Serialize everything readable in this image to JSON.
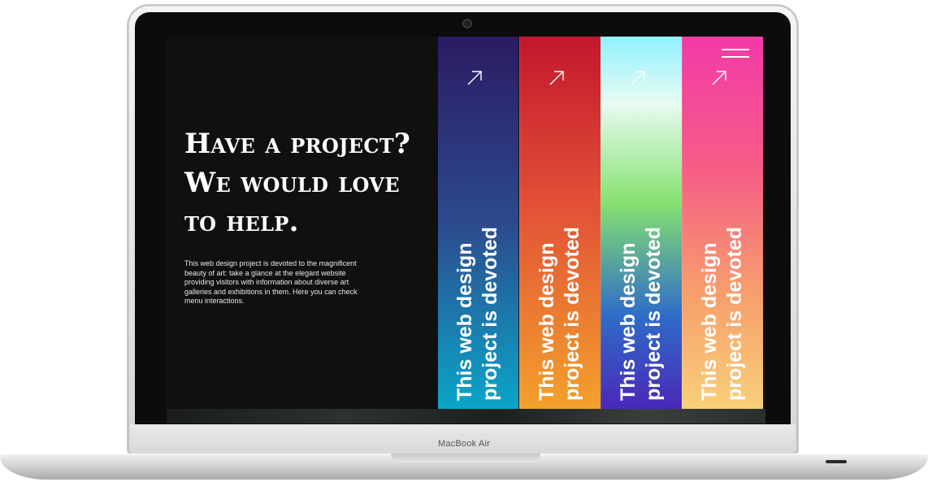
{
  "device": {
    "brand_label": "MacBook Air"
  },
  "hero": {
    "headline_lines": [
      "Have a project?",
      "We would love",
      "to help."
    ],
    "description": "This web design project is devoted to the magnificent beauty of art: take a glance at the elegant website providing visitors with information about diverse art galleries and exhibitions in them. Here you can check menu interactions."
  },
  "panels": [
    {
      "label_line1": "This web design",
      "label_line2": "project is devoted",
      "icon": "arrow-up-right-icon"
    },
    {
      "label_line1": "This web design",
      "label_line2": "project is devoted",
      "icon": "arrow-up-right-icon"
    },
    {
      "label_line1": "This web design",
      "label_line2": "project is devoted",
      "icon": "arrow-up-right-icon"
    },
    {
      "label_line1": "This web design",
      "label_line2": "project is devoted",
      "icon": "arrow-up-right-icon"
    }
  ],
  "menu": {
    "icon": "hamburger-menu-icon"
  },
  "colors": {
    "screen_bg": "#101010",
    "panel_1": [
      "#2b1b63",
      "#0aa6c8"
    ],
    "panel_2": [
      "#c3172d",
      "#f3a12c"
    ],
    "panel_3": [
      "#8ff2ff",
      "#4a28b8"
    ],
    "panel_4": [
      "#f23aa8",
      "#f9d07a"
    ]
  }
}
